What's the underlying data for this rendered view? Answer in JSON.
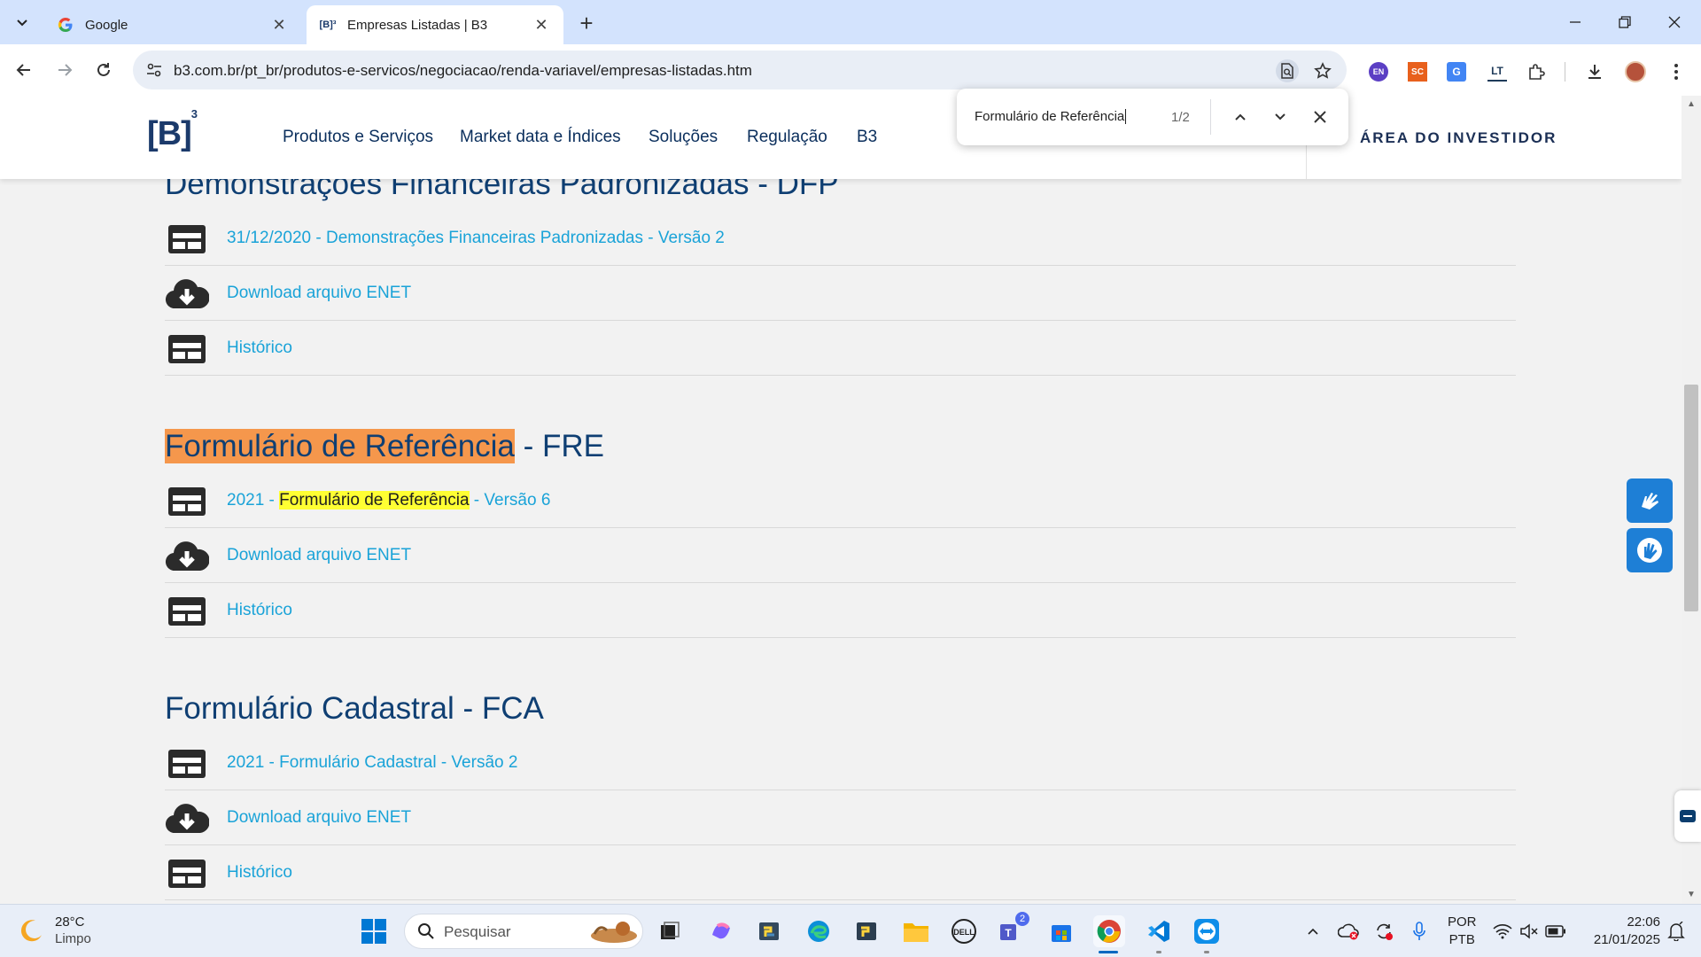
{
  "browser": {
    "tabs": [
      {
        "title": "Google",
        "favicon": "google-g-icon"
      },
      {
        "title": "Empresas Listadas | B3",
        "favicon": "b3-favicon-icon",
        "favicon_text": "[B]³"
      }
    ],
    "url": "b3.com.br/pt_br/produtos-e-servicos/negociacao/renda-variavel/empresas-listadas.htm",
    "extensions": [
      {
        "name": "en-extension-icon",
        "label": "EN",
        "color": "#5b3fc4"
      },
      {
        "name": "sc-extension-icon",
        "label": "SC",
        "color": "#e8601c"
      },
      {
        "name": "google-translate-icon",
        "label": "G",
        "color": "#4285f4"
      },
      {
        "name": "languagetool-icon",
        "label": "LT",
        "color": "#1f3b5a"
      }
    ]
  },
  "findbar": {
    "query": "Formulário de Referência",
    "count": "1/2"
  },
  "site": {
    "logo": "[B]",
    "logo_sup": "3",
    "menu": [
      "Produtos e Serviços",
      "Market data e Índices",
      "Soluções",
      "Regulação",
      "B3"
    ],
    "investor_area": "ÁREA DO INVESTIDOR"
  },
  "sections": [
    {
      "title": "Demonstrações Financeiras Padronizadas - DFP",
      "rows": [
        {
          "icon": "document-icon",
          "text": "31/12/2020 - Demonstrações Financeiras Padronizadas - Versão 2"
        },
        {
          "icon": "cloud-download-icon",
          "text": "Download arquivo ENET"
        },
        {
          "icon": "document-icon",
          "text": "Histórico"
        }
      ]
    },
    {
      "title_highlight": "Formulário de Referência",
      "title_rest": " - FRE",
      "rows": [
        {
          "icon": "document-icon",
          "pre": "2021 - ",
          "highlight": "Formulário de Referência",
          "post": " - Versão 6"
        },
        {
          "icon": "cloud-download-icon",
          "text": "Download arquivo ENET"
        },
        {
          "icon": "document-icon",
          "text": "Histórico"
        }
      ]
    },
    {
      "title": "Formulário Cadastral - FCA",
      "rows": [
        {
          "icon": "document-icon",
          "text": "2021 - Formulário Cadastral - Versão 2"
        },
        {
          "icon": "cloud-download-icon",
          "text": "Download arquivo ENET"
        },
        {
          "icon": "document-icon",
          "text": "Histórico"
        }
      ]
    }
  ],
  "taskbar": {
    "weather": {
      "temp": "28°C",
      "condition": "Limpo"
    },
    "search_placeholder": "Pesquisar",
    "teams_badge": "2",
    "language": {
      "line1": "POR",
      "line2": "PTB"
    },
    "clock": {
      "time": "22:06",
      "date": "21/01/2025"
    }
  },
  "colors": {
    "link": "#1aa3d8",
    "heading": "#0f3f73",
    "find_active_highlight": "#f5974c",
    "find_highlight": "#ffff33",
    "a11y_button": "#1e7fd6"
  }
}
